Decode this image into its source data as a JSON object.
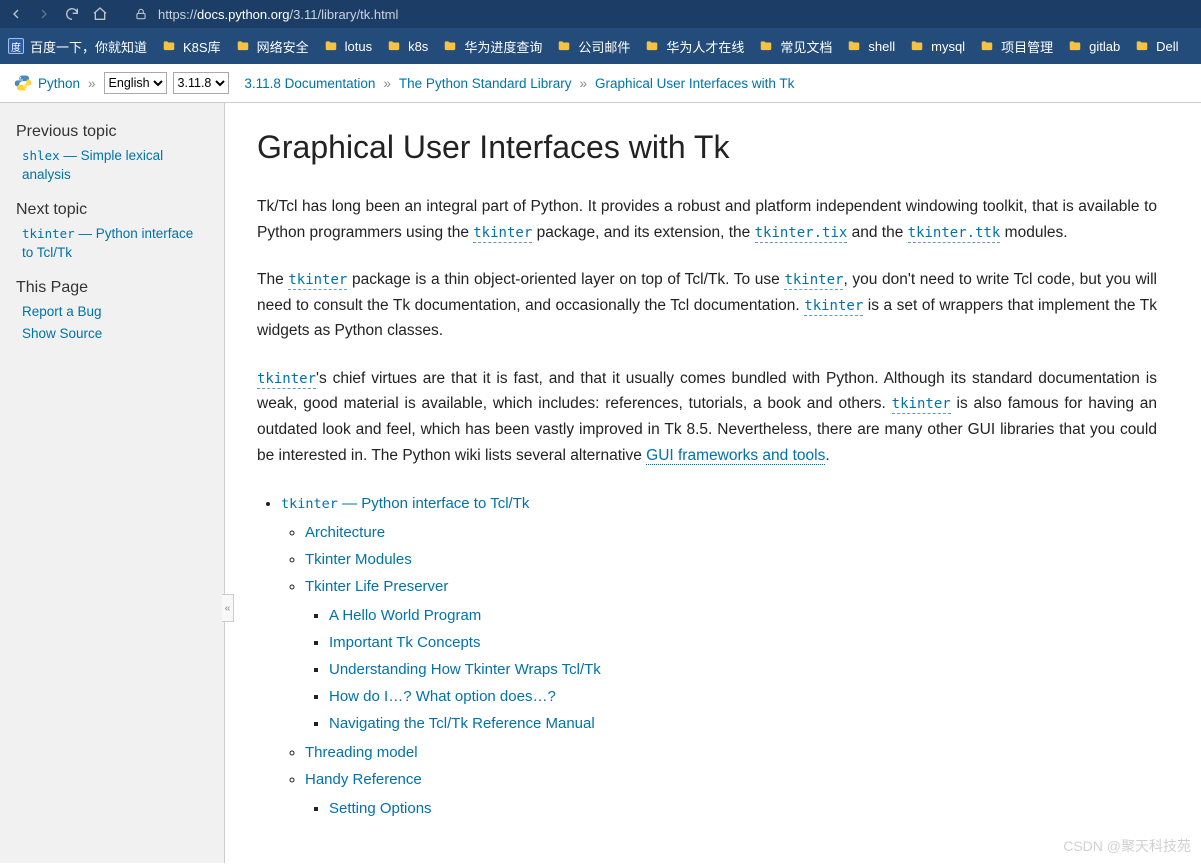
{
  "browser": {
    "url_prefix": "https://",
    "url_domain": "docs.python.org",
    "url_path": "/3.11/library/tk.html"
  },
  "bookmarks": [
    {
      "label": "百度一下，你就知道",
      "type": "baidu"
    },
    {
      "label": "K8S库",
      "type": "folder"
    },
    {
      "label": "网络安全",
      "type": "folder"
    },
    {
      "label": "lotus",
      "type": "folder"
    },
    {
      "label": "k8s",
      "type": "folder"
    },
    {
      "label": "华为进度查询",
      "type": "folder"
    },
    {
      "label": "公司邮件",
      "type": "folder"
    },
    {
      "label": "华为人才在线",
      "type": "folder"
    },
    {
      "label": "常见文档",
      "type": "folder"
    },
    {
      "label": "shell",
      "type": "folder"
    },
    {
      "label": "mysql",
      "type": "folder"
    },
    {
      "label": "项目管理",
      "type": "folder"
    },
    {
      "label": "gitlab",
      "type": "folder"
    },
    {
      "label": "Dell",
      "type": "folder"
    }
  ],
  "doc_nav": {
    "python_label": "Python",
    "lang_value": "English",
    "version_value": "3.11.8",
    "crumbs": [
      "3.11.8 Documentation",
      "The Python Standard Library",
      "Graphical User Interfaces with Tk"
    ]
  },
  "sidebar": {
    "prev_heading": "Previous topic",
    "prev_code": "shlex",
    "prev_rest": " — Simple lexical analysis",
    "next_heading": "Next topic",
    "next_code": "tkinter",
    "next_rest": " — Python interface to Tcl/Tk",
    "this_page_heading": "This Page",
    "report_bug": "Report a Bug",
    "show_source": "Show Source",
    "collapse_glyph": "«"
  },
  "content": {
    "title": "Graphical User Interfaces with Tk",
    "p1a": "Tk/Tcl has long been an integral part of Python. It provides a robust and platform independent windowing toolkit, that is available to Python programmers using the ",
    "p1b": " package, and its extension, the ",
    "p1c": " and the ",
    "p1d": " modules.",
    "code_tkinter": "tkinter",
    "code_tix": "tkinter.tix",
    "code_ttk": "tkinter.ttk",
    "p2a": "The ",
    "p2b": " package is a thin object-oriented layer on top of Tcl/Tk. To use ",
    "p2c": ", you don't need to write Tcl code, but you will need to consult the Tk documentation, and occasionally the Tcl documentation. ",
    "p2d": " is a set of wrappers that implement the Tk widgets as Python classes.",
    "p3a": "'s chief virtues are that it is fast, and that it usually comes bundled with Python. Although its standard documentation is weak, good material is available, which includes: references, tutorials, a book and others. ",
    "p3b": " is also famous for having an outdated look and feel, which has been vastly improved in Tk 8.5. Nevertheless, there are many other GUI libraries that you could be interested in. The Python wiki lists several alternative ",
    "gui_link": "GUI frameworks and tools",
    "period": ".",
    "toc_top_sep": " — Python interface to Tcl/Tk",
    "toc": {
      "l1": [
        "Architecture",
        "Tkinter Modules",
        "Tkinter Life Preserver",
        "Threading model",
        "Handy Reference"
      ],
      "l2_life": [
        "A Hello World Program",
        "Important Tk Concepts",
        "Understanding How Tkinter Wraps Tcl/Tk",
        "How do I…? What option does…?",
        "Navigating the Tcl/Tk Reference Manual"
      ],
      "l2_handy": [
        "Setting Options"
      ]
    }
  },
  "watermark": "CSDN @聚天科技苑"
}
